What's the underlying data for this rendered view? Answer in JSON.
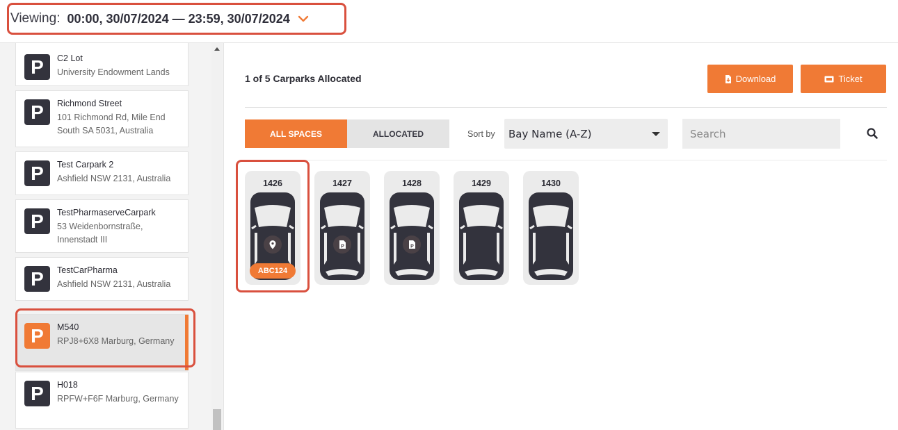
{
  "header": {
    "viewing_label": "Viewing:",
    "viewing_range": "00:00, 30/07/2024 — 23:59, 30/07/2024"
  },
  "colors": {
    "accent": "#f07a35",
    "highlight_outline": "#d9503e",
    "dark": "#33333d"
  },
  "carparks": [
    {
      "name": "C2 Lot",
      "address": "University Endowment Lands",
      "selected": false
    },
    {
      "name": "Richmond Street",
      "address": "101 Richmond Rd, Mile End South SA 5031, Australia",
      "selected": false
    },
    {
      "name": "Test Carpark 2",
      "address": "Ashfield NSW 2131, Australia",
      "selected": false
    },
    {
      "name": "TestPharmaserveCarpark",
      "address": "53 Weidenbornstraße, Innenstadt III",
      "selected": false
    },
    {
      "name": "TestCarPharma",
      "address": "Ashfield NSW 2131, Australia",
      "selected": false
    },
    {
      "name": "M540",
      "address": "RPJ8+6X8 Marburg, Germany",
      "selected": true
    },
    {
      "name": "H018",
      "address": "RPFW+F6F Marburg, Germany",
      "selected": false
    }
  ],
  "logo_letter": "P",
  "main": {
    "allocated_count": "1 of 5 Carparks Allocated",
    "download_label": "Download",
    "ticket_label": "Ticket",
    "tabs": [
      {
        "label": "ALL SPACES",
        "active": true
      },
      {
        "label": "ALLOCATED",
        "active": false
      }
    ],
    "sort_label": "Sort by",
    "sort_value": "Bay Name (A-Z)",
    "search_placeholder": "Search"
  },
  "bays": [
    {
      "number": "1426",
      "icon": "location-pin-icon",
      "plate": "ABC124"
    },
    {
      "number": "1427",
      "icon": "parking-document-icon",
      "plate": ""
    },
    {
      "number": "1428",
      "icon": "parking-document-icon",
      "plate": ""
    },
    {
      "number": "1429",
      "icon": "",
      "plate": ""
    },
    {
      "number": "1430",
      "icon": "",
      "plate": ""
    }
  ]
}
